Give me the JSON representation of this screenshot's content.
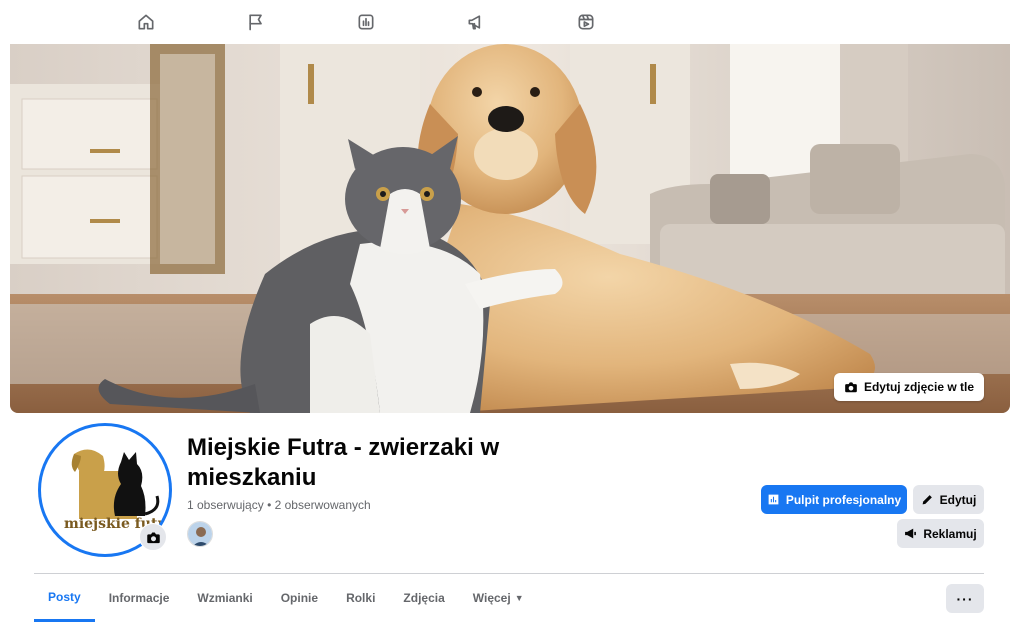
{
  "topnav": {
    "icons": [
      "home-icon",
      "flag-icon",
      "insights-icon",
      "megaphone-icon",
      "reels-icon"
    ]
  },
  "cover": {
    "edit_label": "Edytuj zdjęcie w tle"
  },
  "profile": {
    "logo_text": "miejskie futra",
    "title": "Miejskie Futra - zwierzaki w mieszkaniu",
    "followers": "1 obserwujący",
    "separator": "•",
    "following": "2 obserwowanych"
  },
  "actions": {
    "dashboard_label": "Pulpit profesjonalny",
    "edit_label": "Edytuj",
    "ads_label": "Reklamuj"
  },
  "tabs": [
    {
      "label": "Posty"
    },
    {
      "label": "Informacje"
    },
    {
      "label": "Wzmianki"
    },
    {
      "label": "Opinie"
    },
    {
      "label": "Rolki"
    },
    {
      "label": "Zdjęcia"
    },
    {
      "label": "Więcej"
    }
  ],
  "more_button": "···",
  "colors": {
    "accent": "#1877f2",
    "secondary_button": "#e4e6eb",
    "muted_text": "#65676b"
  }
}
